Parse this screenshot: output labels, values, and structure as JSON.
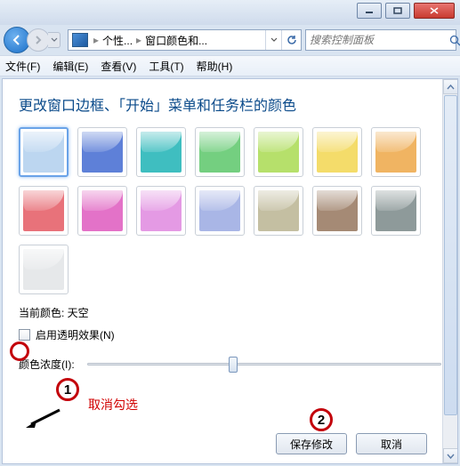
{
  "window": {
    "min_label": "最小化",
    "max_label": "最大化",
    "close_label": "关闭"
  },
  "nav": {
    "back_label": "返回",
    "fwd_label": "前进",
    "addr_seg1": "个性...",
    "addr_seg2": "窗口颜色和...",
    "search_placeholder": "搜索控制面板"
  },
  "menu": {
    "file": "文件(F)",
    "edit": "编辑(E)",
    "view": "查看(V)",
    "tools": "工具(T)",
    "help": "帮助(H)"
  },
  "page": {
    "heading": "更改窗口边框、「开始」菜单和任务栏的颜色",
    "current_label": "当前颜色: 天空",
    "transparency_label": "启用透明效果(N)",
    "intensity_label": "颜色浓度(I):",
    "save_btn": "保存修改",
    "cancel_btn": "取消"
  },
  "swatches": [
    {
      "name": "sky",
      "color": "#bcd6f0",
      "selected": true
    },
    {
      "name": "twilight",
      "color": "#5e80d8"
    },
    {
      "name": "sea",
      "color": "#3fbec0"
    },
    {
      "name": "leaf",
      "color": "#74cf80"
    },
    {
      "name": "lime",
      "color": "#b6e06b"
    },
    {
      "name": "sun",
      "color": "#f4dc6a"
    },
    {
      "name": "pumpkin",
      "color": "#f0b462"
    },
    {
      "name": "ruby",
      "color": "#e8727a"
    },
    {
      "name": "fuchsia",
      "color": "#e372c8"
    },
    {
      "name": "violet",
      "color": "#e49ae4"
    },
    {
      "name": "lavender",
      "color": "#a9b6e6"
    },
    {
      "name": "taupe",
      "color": "#c4bfa2"
    },
    {
      "name": "chocolate",
      "color": "#a58a75"
    },
    {
      "name": "slate",
      "color": "#8e9a9a"
    },
    {
      "name": "frost",
      "color": "#e6e8ea"
    }
  ],
  "annotations": {
    "num1": "1",
    "num2": "2",
    "red_text": "取消勾选"
  }
}
